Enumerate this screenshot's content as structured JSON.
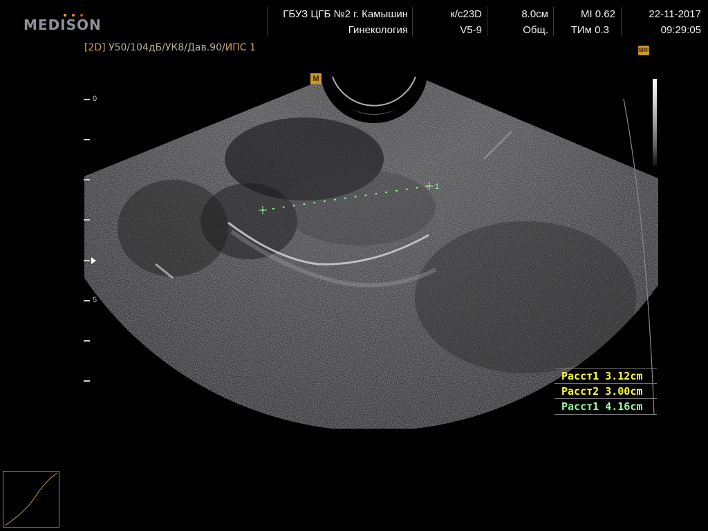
{
  "header": {
    "brand": "MEDISON",
    "brand_dots": [
      "#f5a623",
      "#f08c1a",
      "#e53a2a"
    ],
    "institution": "ГБУЗ ЦГБ №2 г. Камышин",
    "department": "Гинекология",
    "probe": "к/с23D",
    "probe_model": "V5-9",
    "depth": "8.0см",
    "preset": "Общ.",
    "mi": "MI  0.62",
    "tim": "ТИм 0.3",
    "date": "22-11-2017",
    "time": "09:29:05"
  },
  "image_params": {
    "mode": "[2D]",
    "values": " У50/104дБ/УК8/Дав.90/",
    "ips": "ИПС 1"
  },
  "srf_icon": "SRF",
  "m_marker": "M",
  "depth_scale": {
    "labels": [
      {
        "text": "0",
        "depth_cm": 0
      },
      {
        "text": "5",
        "depth_cm": 5
      }
    ],
    "tick_count": 8
  },
  "caliper_label": "1",
  "measurements": [
    {
      "label": "Расст1 3.12cm",
      "color": "#ffff33"
    },
    {
      "label": "Расст2 3.00cm",
      "color": "#ffff33"
    },
    {
      "label": "Расст1 4.16cm",
      "color": "#99ff99"
    }
  ],
  "colors": {
    "accent_orange": "#c9962f",
    "caliper_green": "#99ff99",
    "tgc_curve": "#c8a046"
  }
}
